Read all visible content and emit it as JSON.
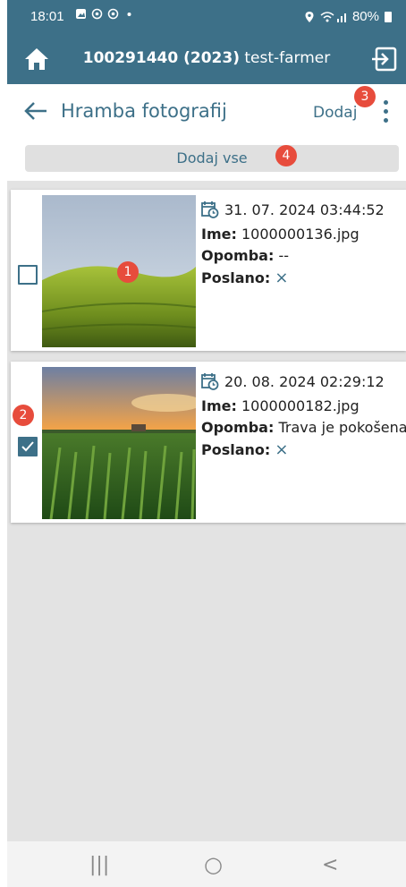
{
  "status": {
    "time": "18:01",
    "battery": "80%"
  },
  "appbar": {
    "id_label": "100291440 (2023)",
    "user": "test-farmer"
  },
  "header": {
    "title": "Hramba fotografij",
    "add_label": "Dodaj"
  },
  "add_all_label": "Dodaj vse",
  "labels": {
    "name": "Ime:",
    "note": "Opomba:",
    "sent": "Poslano:"
  },
  "photos": [
    {
      "datetime": "31. 07. 2024 03:44:52",
      "name": "1000000136.jpg",
      "note": "--",
      "sent_icon": "×",
      "checked": false
    },
    {
      "datetime": "20. 08. 2024 02:29:12",
      "name": "1000000182.jpg",
      "note": "Trava je pokošena",
      "sent_icon": "×",
      "checked": true
    }
  ],
  "badges": [
    "1",
    "2",
    "3",
    "4"
  ],
  "colors": {
    "primary": "#3d7088",
    "badge": "#e74c3c",
    "background": "#e3e3e3"
  },
  "icons": [
    "home-icon",
    "logout-icon",
    "back-icon",
    "more-vert-icon",
    "calendar-clock-icon",
    "close-icon"
  ],
  "navbar": {
    "recent": "|||",
    "home": "○",
    "back": "<"
  }
}
